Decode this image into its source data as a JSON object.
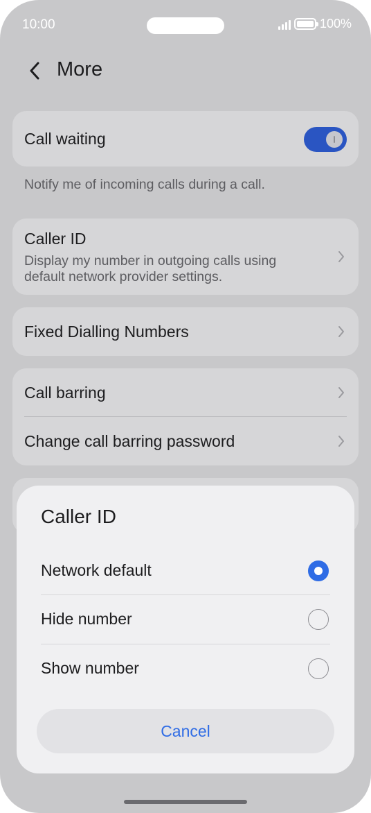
{
  "status_bar": {
    "time": "10:00",
    "battery": "100%",
    "signal_icon": "signal-bars-icon",
    "battery_icon": "battery-full-icon"
  },
  "header": {
    "back_icon": "chevron-left-icon",
    "title": "More"
  },
  "call_waiting": {
    "label": "Call waiting",
    "enabled": true,
    "helper": "Notify me of incoming calls during a call."
  },
  "caller_id": {
    "label": "Caller ID",
    "description": "Display my number in outgoing calls using default network provider settings."
  },
  "fixed_dialling": {
    "label": "Fixed Dialling Numbers"
  },
  "call_barring": {
    "label": "Call barring",
    "password_label": "Change call barring password"
  },
  "dialog": {
    "title": "Caller ID",
    "options": [
      {
        "label": "Network default",
        "selected": true
      },
      {
        "label": "Hide number",
        "selected": false
      },
      {
        "label": "Show number",
        "selected": false
      }
    ],
    "cancel_label": "Cancel"
  },
  "colors": {
    "accent": "#2f6ce5",
    "toggle_on": "#2a55c2",
    "dim_background": "#c8c8ca"
  }
}
